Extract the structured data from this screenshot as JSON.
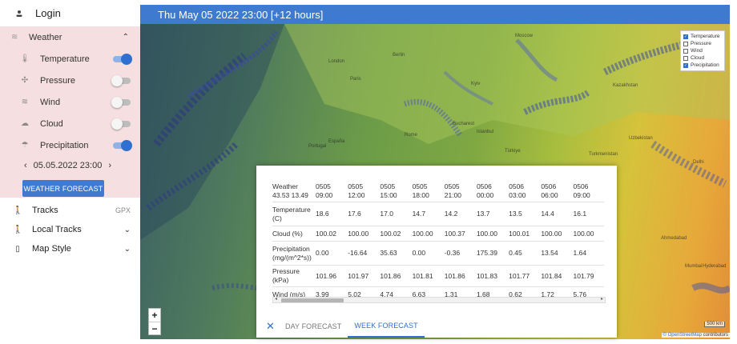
{
  "sidebar": {
    "login_label": "Login",
    "weather": {
      "title": "Weather",
      "layers": [
        {
          "label": "Temperature",
          "icon": "thermometer-icon",
          "on": true
        },
        {
          "label": "Pressure",
          "icon": "pressure-icon",
          "on": false
        },
        {
          "label": "Wind",
          "icon": "wind-icon",
          "on": false
        },
        {
          "label": "Cloud",
          "icon": "cloud-icon",
          "on": false
        },
        {
          "label": "Precipitation",
          "icon": "umbrella-icon",
          "on": true
        }
      ],
      "date": "05.05.2022 23:00",
      "forecast_button": "WEATHER FORECAST"
    },
    "tracks": {
      "label": "Tracks",
      "badge": "GPX"
    },
    "local_tracks": {
      "label": "Local Tracks"
    },
    "map_style": {
      "label": "Map Style"
    }
  },
  "topbar": {
    "title": "Thu May 05 2022 23:00 [+12 hours]"
  },
  "map": {
    "legend": [
      {
        "label": "Temperature",
        "checked": true
      },
      {
        "label": "Pressure",
        "checked": false
      },
      {
        "label": "Wind",
        "checked": false
      },
      {
        "label": "Cloud",
        "checked": false
      },
      {
        "label": "Precipitation",
        "checked": true
      }
    ],
    "labels": [
      "London",
      "Paris",
      "Berlin",
      "Moscow",
      "Kyiv",
      "Bucharest",
      "Istanbul",
      "Türkiye",
      "Kazakhstan",
      "Uzbekistan",
      "Turkmenistan",
      "Portugal",
      "España",
      "Rome",
      "Delhi",
      "Mumbai",
      "Hyderabad",
      "Ahmedabad"
    ],
    "zoom_in": "+",
    "zoom_out": "−",
    "scale": "500 km",
    "attribution_link": "© OpenStreetMap",
    "attribution_rest": " contributors"
  },
  "forecast": {
    "location_title": "Weather",
    "location_coords": "43.53 13.49",
    "columns": [
      {
        "date": "0505",
        "time": "09:00"
      },
      {
        "date": "0505",
        "time": "12:00"
      },
      {
        "date": "0505",
        "time": "15:00"
      },
      {
        "date": "0505",
        "time": "18:00"
      },
      {
        "date": "0505",
        "time": "21:00"
      },
      {
        "date": "0506",
        "time": "00:00"
      },
      {
        "date": "0506",
        "time": "03:00"
      },
      {
        "date": "0506",
        "time": "06:00"
      },
      {
        "date": "0506",
        "time": "09:00"
      }
    ],
    "rows": [
      {
        "label": "Temperature (C)",
        "values": [
          "18.6",
          "17.6",
          "17.0",
          "14.7",
          "14.2",
          "13.7",
          "13.5",
          "14.4",
          "16.1"
        ]
      },
      {
        "label": "Cloud (%)",
        "values": [
          "100.02",
          "100.00",
          "100.02",
          "100.00",
          "100.37",
          "100.00",
          "100.01",
          "100.00",
          "100.00"
        ]
      },
      {
        "label": "Precipitation (mg/(m^2*s))",
        "values": [
          "0.00",
          "-16.64",
          "35.63",
          "0.00",
          "-0.36",
          "175.39",
          "0.45",
          "13.54",
          "1.64"
        ]
      },
      {
        "label": "Pressure (kPa)",
        "values": [
          "101.96",
          "101.97",
          "101.86",
          "101.81",
          "101.86",
          "101.83",
          "101.77",
          "101.84",
          "101.79"
        ]
      },
      {
        "label": "Wind (m/s)",
        "values": [
          "3.99",
          "5.02",
          "4.74",
          "6.63",
          "1.31",
          "1.68",
          "0.62",
          "1.72",
          "5.76"
        ]
      }
    ],
    "tabs": [
      {
        "label": "DAY FORECAST",
        "active": false
      },
      {
        "label": "WEEK FORECAST",
        "active": true
      }
    ],
    "close_symbol": "✕"
  }
}
